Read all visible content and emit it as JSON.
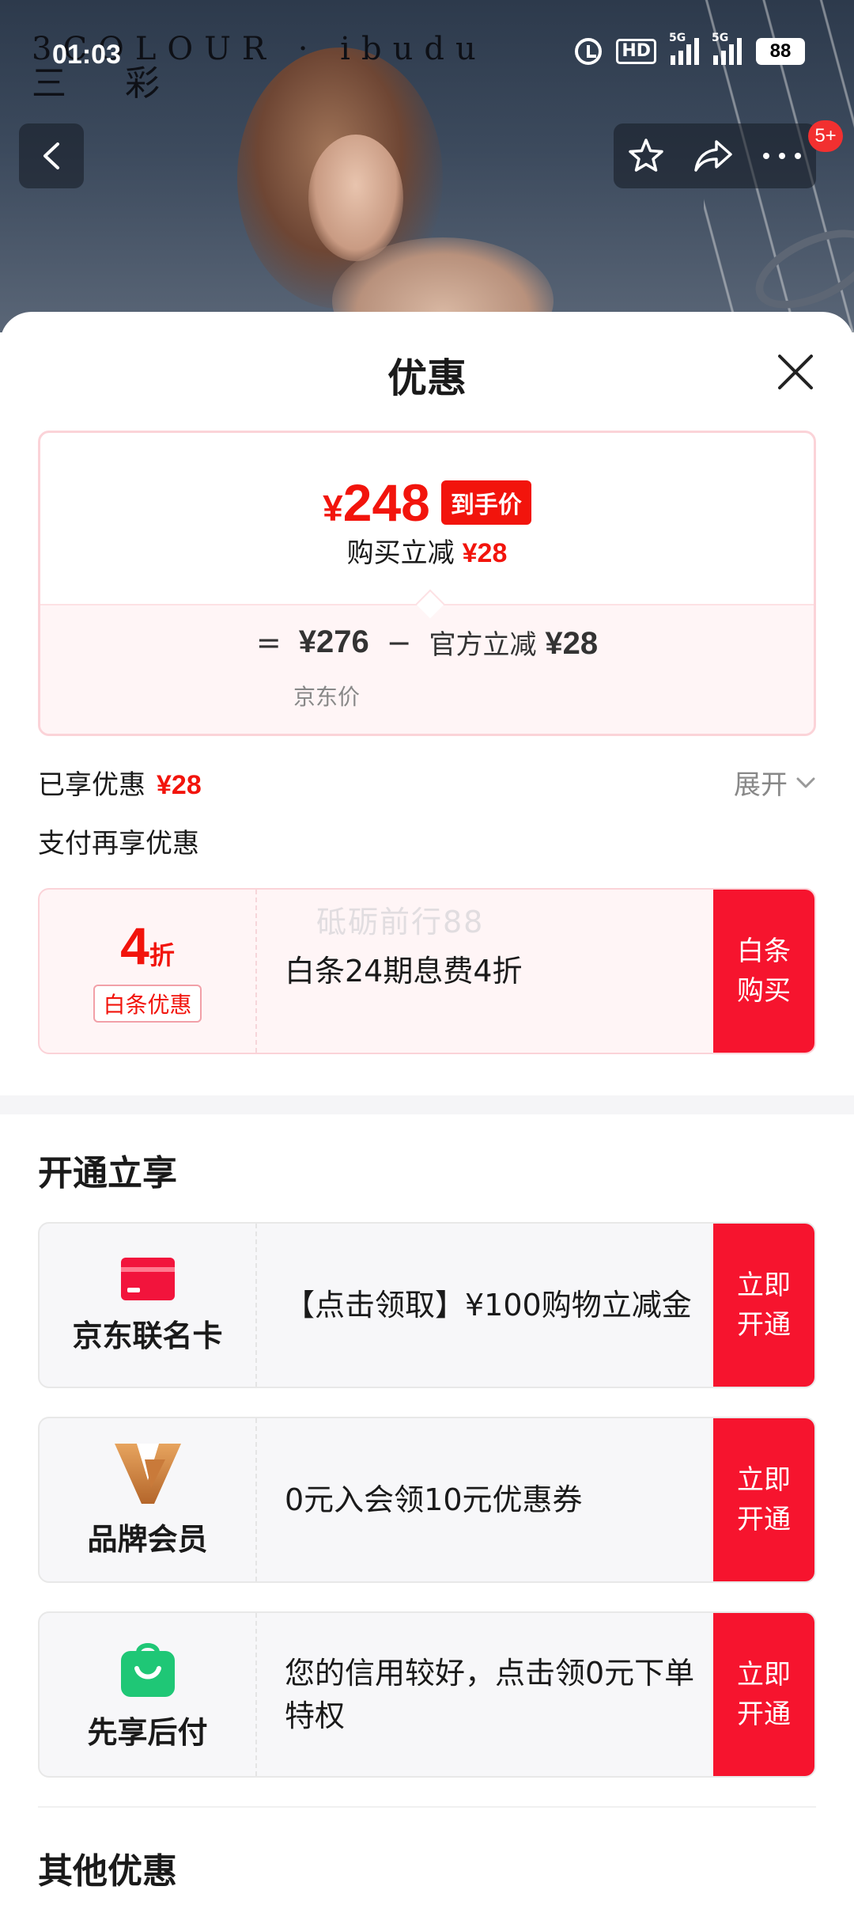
{
  "status_bar": {
    "time": "01:03",
    "hd": "HD",
    "net1": "5G",
    "net2": "5G",
    "battery": "88"
  },
  "header": {
    "brand_line1": "3COLOUR · ibudu",
    "brand_line2": "三 彩",
    "badge": "5+"
  },
  "sheet": {
    "title": "优惠",
    "price_card": {
      "currency": "¥",
      "final_price": "248",
      "final_tag": "到手价",
      "reduce_label": "购买立减",
      "reduce_amount": "¥28",
      "equals": "=",
      "jd_price": "¥276",
      "minus": "−",
      "official_label": "官方立减",
      "official_amount": "¥28",
      "jd_price_label": "京东价"
    },
    "enjoyed_label": "已享优惠",
    "enjoyed_amount": "¥28",
    "expand_label": "展开",
    "pay_more_label": "支付再享优惠",
    "watermark": "砥砺前行88",
    "baitiao_offer": {
      "discount": "4",
      "discount_unit": "折",
      "tag": "白条优惠",
      "desc": "白条24期息费4折",
      "action": "白条购买"
    },
    "open_section_title": "开通立享",
    "open_offers": [
      {
        "name": "京东联名卡",
        "icon": "card-icon",
        "desc": "【点击领取】¥100购物立减金",
        "action": "立即开通"
      },
      {
        "name": "品牌会员",
        "icon": "brand-v-icon",
        "desc": "0元入会领10元优惠券",
        "action": "立即开通"
      },
      {
        "name": "先享后付",
        "icon": "shopping-bag-icon",
        "desc": "您的信用较好，点击领0元下单特权",
        "action": "立即开通"
      }
    ],
    "other_section_title": "其他优惠"
  },
  "colors": {
    "accent_red": "#f2140c",
    "button_red": "#f6142e",
    "card_pink_bg": "#fff5f6"
  }
}
